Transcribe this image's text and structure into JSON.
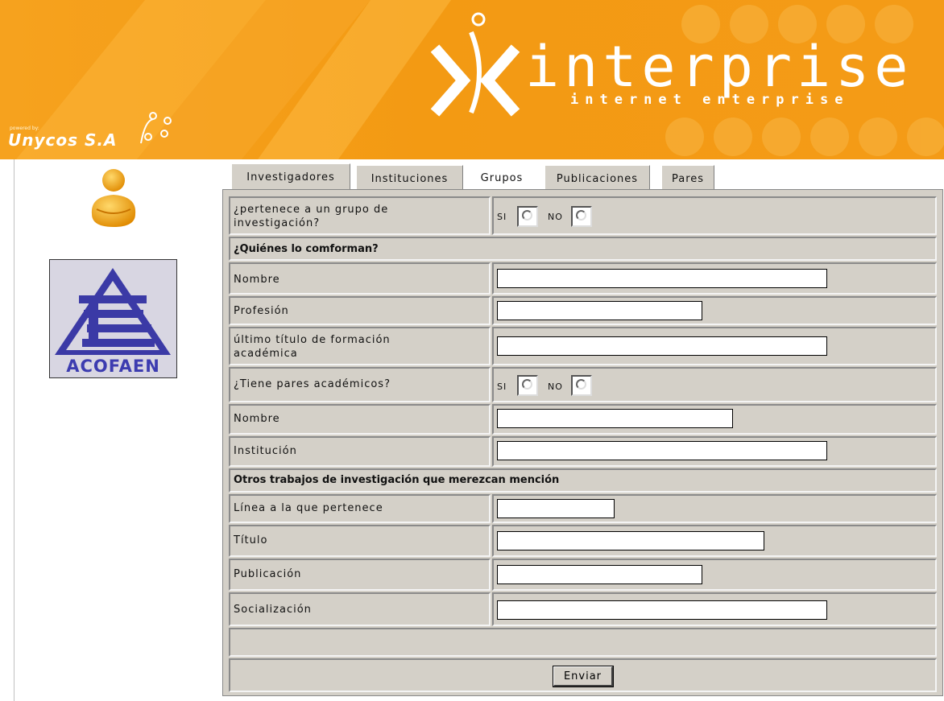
{
  "header": {
    "brand_name": "interprise",
    "brand_tagline": "internet enterprise",
    "powered_by": "powered by:",
    "company": "Unycos S.A"
  },
  "sidebar": {
    "partner_logo_text": "ACOFAEN"
  },
  "tabs": [
    {
      "label": "Investigadores"
    },
    {
      "label": "Instituciones"
    },
    {
      "label": "Grupos",
      "active": true
    },
    {
      "label": "Publicaciones"
    },
    {
      "label": "Pares"
    }
  ],
  "form": {
    "belongs_group": {
      "label": "¿pertenece a un grupo de investigación?",
      "si": "SI",
      "no": "NO"
    },
    "section_members": "¿Quiénes lo comforman?",
    "name1": {
      "label": "Nombre",
      "value": ""
    },
    "profession": {
      "label": "Profesión",
      "value": ""
    },
    "last_degree": {
      "label": "último título de formación académica",
      "value": ""
    },
    "has_peers": {
      "label": "¿Tiene pares académicos?",
      "si": "SI",
      "no": "NO"
    },
    "name2": {
      "label": "Nombre",
      "value": ""
    },
    "institution": {
      "label": "Institución",
      "value": ""
    },
    "section_other": "Otros trabajos de investigación que merezcan mención",
    "line": {
      "label": "Línea a la que pertenece",
      "value": ""
    },
    "title": {
      "label": "Título",
      "value": ""
    },
    "publication": {
      "label": "Publicación",
      "value": ""
    },
    "socialization": {
      "label": "Socialización",
      "value": ""
    },
    "submit_label": "Enviar"
  },
  "colors": {
    "header_orange": "#f49b17",
    "panel_gray": "#d4d0c8",
    "logo_blue": "#3c3cb0"
  }
}
